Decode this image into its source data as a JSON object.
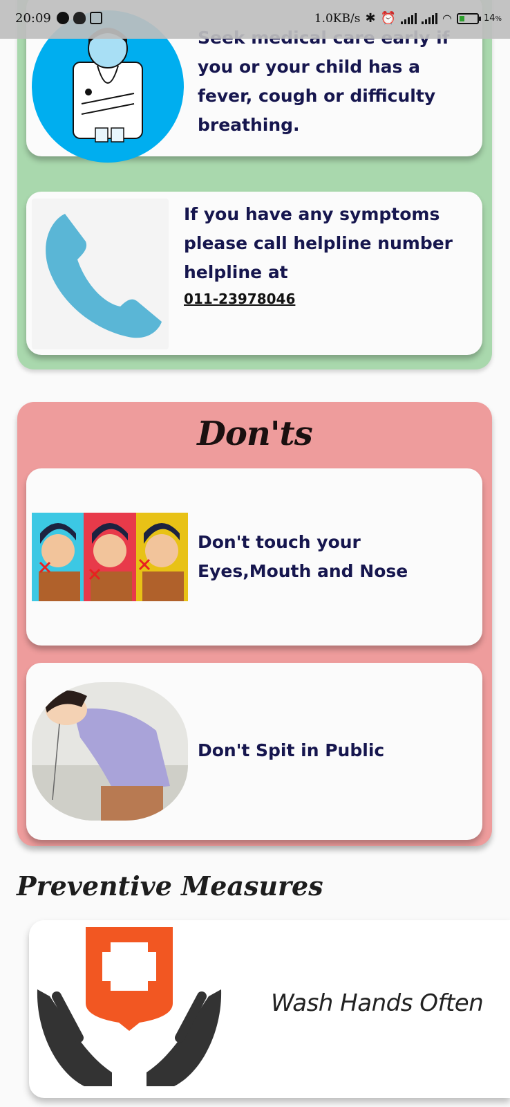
{
  "status_bar": {
    "time": "20:09",
    "network_speed": "1.0KB/s",
    "battery_percent": "14",
    "battery_suffix": "%"
  },
  "dos": {
    "cards": [
      {
        "icon": "doctor-icon",
        "text": "Seek medical care early if you or your child has a fever, cough or difficulty breathing."
      },
      {
        "icon": "phone-icon",
        "text": "If you have any symptoms please call helpline number helpline at",
        "phone": "011-23978046"
      }
    ]
  },
  "donts": {
    "title": "Don'ts",
    "cards": [
      {
        "icon": "no-touch-face-icon",
        "text": "Don't touch your Eyes,Mouth and Nose"
      },
      {
        "icon": "no-spit-icon",
        "text": "Don't Spit in Public"
      }
    ]
  },
  "preventive": {
    "title": "Preventive Measures",
    "cards": [
      {
        "icon": "hands-cross-icon",
        "text": "Wash Hands Often"
      }
    ]
  },
  "colors": {
    "green_panel": "#a9d8ad",
    "red_panel": "#ee9c9c",
    "card_text": "#16164e",
    "doctor_circle": "#00aeef",
    "phone_blue": "#5ab6d6",
    "cross_orange": "#f25722"
  }
}
